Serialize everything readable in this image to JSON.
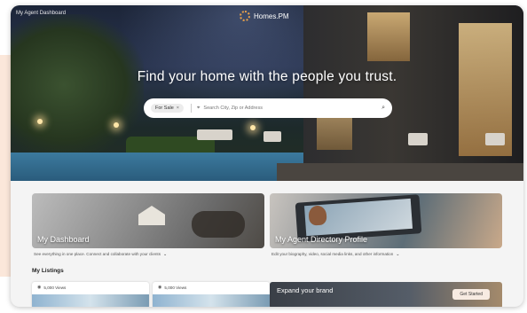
{
  "header": {
    "agent_label": "My Agent Dashboard",
    "logo_text": "Homes.PM"
  },
  "hero": {
    "headline": "Find your home with the people you trust.",
    "search": {
      "mode": "For Sale",
      "mode_clear": "×",
      "placeholder": "Search City, Zip or Address",
      "pin_icon": "map-pin-icon",
      "search_icon": "search-icon"
    }
  },
  "tiles": [
    {
      "title": "My Dashboard",
      "description": "See everything in one place. Connect and collaborate with your clients"
    },
    {
      "title": "My Agent Directory Profile",
      "description": "Edit your biography, video, social media links, and other information"
    }
  ],
  "listings": {
    "title": "My Listings",
    "cards": [
      {
        "views": "5,000 Views"
      },
      {
        "views": "5,000 Views"
      }
    ]
  },
  "promo": {
    "text": "Expand your brand",
    "button": "Get Started"
  },
  "colors": {
    "accent": "#e9a04b",
    "promo_button": "#f7ebe2"
  }
}
